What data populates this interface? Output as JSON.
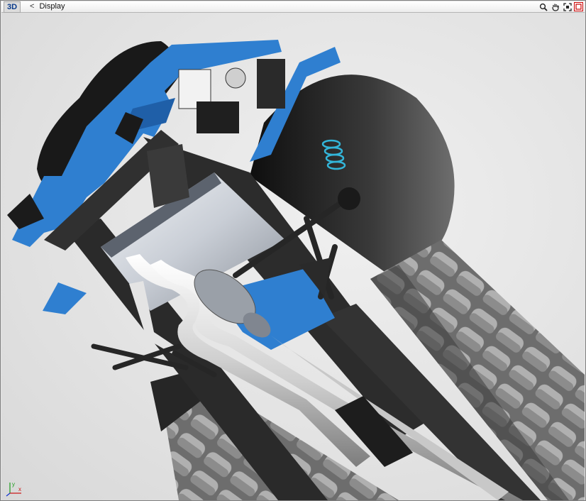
{
  "toolbar": {
    "mode_label": "3D",
    "breadcrumb_chevron": "<",
    "breadcrumb_label": "Display",
    "tools": [
      {
        "icon": "zoom-icon"
      },
      {
        "icon": "pan-hand-icon"
      },
      {
        "icon": "fit-view-icon"
      },
      {
        "icon": "close-icon"
      }
    ]
  },
  "gizmo": {
    "x_label": "x",
    "y_label": "y"
  },
  "colors": {
    "accent_blue": "#2f7fd0",
    "frame_dark": "#2a2a2a",
    "tire": "#1c1c1c",
    "pipe": "#cfcfcf"
  }
}
